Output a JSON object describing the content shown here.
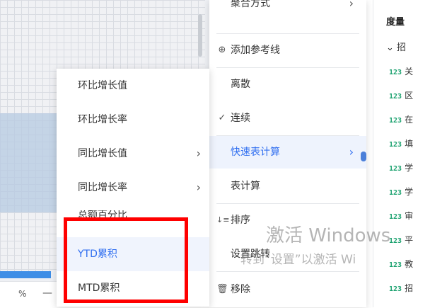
{
  "canvas": {
    "zoom_label": "%",
    "minus_label": "—"
  },
  "main_menu": {
    "items": [
      {
        "label": "聚合方式",
        "chevron": "›"
      },
      {
        "label": "添加参考线",
        "prefix": "⊕"
      },
      {
        "label": "离散"
      },
      {
        "label": "连续",
        "prefix": "✓"
      },
      {
        "label": "快速表计算",
        "chevron": "›"
      },
      {
        "label": "表计算"
      },
      {
        "label": "排序",
        "prefix": "↓≡"
      },
      {
        "label": "设置跳转"
      },
      {
        "label": "移除",
        "prefix": "🗑"
      }
    ]
  },
  "submenu": {
    "items": [
      {
        "label": "环比增长值"
      },
      {
        "label": "环比增长率"
      },
      {
        "label": "同比增长值",
        "chevron": "›"
      },
      {
        "label": "同比增长率",
        "chevron": "›"
      },
      {
        "label": "总额百分比"
      },
      {
        "label": "YTD累积"
      },
      {
        "label": "MTD累积"
      }
    ]
  },
  "right_panel": {
    "title": "度量",
    "group": "招",
    "group_chevron": "⌄",
    "badge": "123",
    "fields": [
      "关",
      "区",
      "在",
      "填",
      "学",
      "学",
      "审",
      "平",
      "教",
      "招"
    ]
  },
  "watermark": {
    "line1": "激活 Windows",
    "line2": "转到“设置”以激活 Wi"
  },
  "colors": {
    "accent": "#2f6ef0",
    "highlight": "#ff0000",
    "badge": "#1aa16e"
  }
}
